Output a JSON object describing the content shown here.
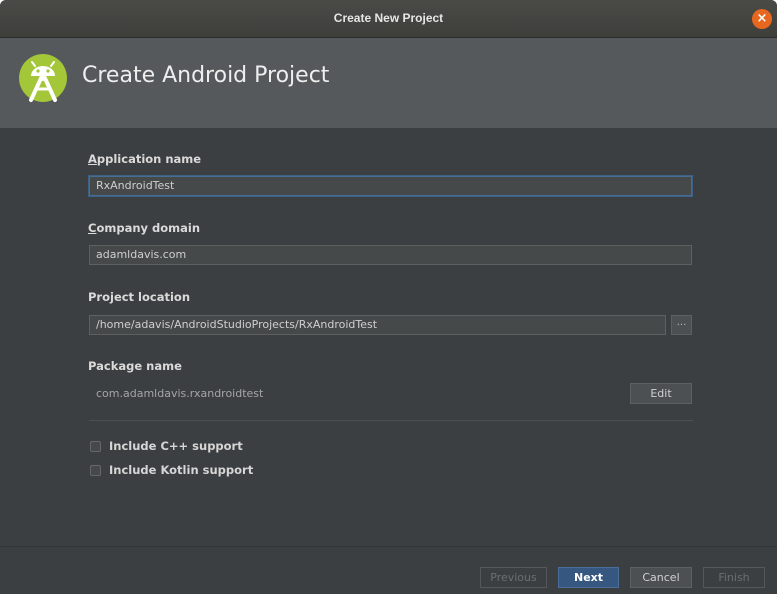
{
  "window": {
    "title": "Create New Project",
    "close_glyph": "×"
  },
  "header": {
    "logo_icon": "android-studio-icon",
    "title": "Create Android Project"
  },
  "form": {
    "application_name": {
      "label_mnemonic": "A",
      "label_rest": "pplication name",
      "value": "RxAndroidTest"
    },
    "company_domain": {
      "label_mnemonic": "C",
      "label_rest": "ompany domain",
      "value": "adamldavis.com"
    },
    "project_location": {
      "label": "Project location",
      "value": "/home/adavis/AndroidStudioProjects/RxAndroidTest",
      "browse_label": "..."
    },
    "package_name": {
      "label": "Package name",
      "value": "com.adamldavis.rxandroidtest",
      "edit_label": "Edit"
    },
    "options": [
      {
        "label": "Include C++ support",
        "checked": false
      },
      {
        "label": "Include Kotlin support",
        "checked": false
      }
    ]
  },
  "footer": {
    "previous_label": "Previous",
    "next_label": "Next",
    "cancel_label": "Cancel",
    "finish_label": "Finish"
  },
  "colors": {
    "background": "#3c3f41",
    "header": "#55595b",
    "primary_button": "#365880",
    "close_button": "#e8671e",
    "android_green": "#a4c639"
  }
}
